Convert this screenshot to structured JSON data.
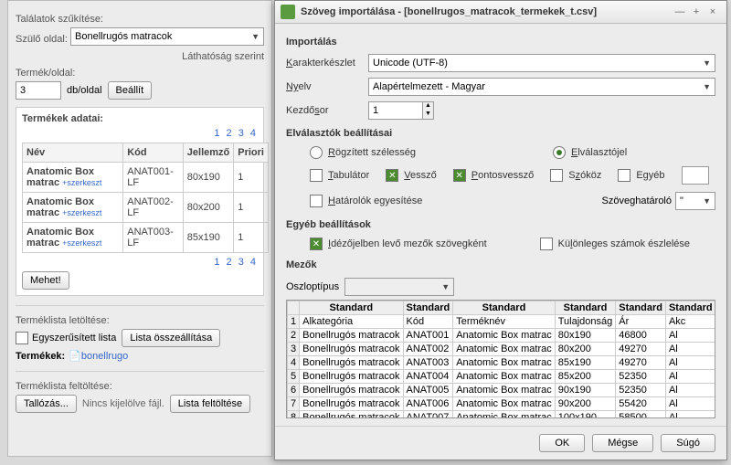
{
  "bg": {
    "filter_label": "Találatok szűkítése:",
    "parent_label": "Szülő oldal:",
    "parent_value": "Bonellrugós matracok",
    "visibility_label": "Láthatóság szerint",
    "perpage_label": "Termék/oldal:",
    "perpage_value": "3",
    "perpage_unit": "db/oldal",
    "set_btn": "Beállít",
    "products_title": "Termékek adatai:",
    "pager": [
      "1",
      "2",
      "3",
      "4"
    ],
    "cols": {
      "name": "Név",
      "code": "Kód",
      "attr": "Jellemző",
      "prio": "Priori"
    },
    "rows": [
      {
        "name": "Anatomic Box matrac",
        "edit": "+szerkeszt",
        "code": "ANAT001-LF",
        "attr": "80x190",
        "prio": "1"
      },
      {
        "name": "Anatomic Box matrac",
        "edit": "+szerkeszt",
        "code": "ANAT002-LF",
        "attr": "80x200",
        "prio": "1"
      },
      {
        "name": "Anatomic Box matrac",
        "edit": "+szerkeszt",
        "code": "ANAT003-LF",
        "attr": "85x190",
        "prio": "1"
      }
    ],
    "go_btn": "Mehet!",
    "download_label": "Terméklista letöltése:",
    "simplified": "Egyszerűsített lista",
    "compile_btn": "Lista összeállítása",
    "products_link_label": "Termékek:",
    "products_link": "bonellrugo",
    "upload_label": "Terméklista feltöltése:",
    "browse_btn": "Tallózás...",
    "no_file": "Nincs kijelölve fájl.",
    "upload_btn": "Lista feltöltése"
  },
  "dlg": {
    "title": "Szöveg importálása - [bonellrugos_matracok_termekek_t.csv]",
    "sec_import": "Importálás",
    "charset_label": "Karakterkészlet",
    "charset_value": "Unicode (UTF-8)",
    "lang_label": "Nyelv",
    "lang_value": "Alapértelmezett - Magyar",
    "startrow_label": "Kezdősor",
    "startrow_value": "1",
    "sec_sep": "Elválasztók beállításai",
    "fixed_width": "Rögzített szélesség",
    "delimiter": "Elválasztójel",
    "tab": "Tabulátor",
    "comma": "Vessző",
    "semicolon": "Pontosvessző",
    "space": "Szóköz",
    "other": "Egyéb",
    "merge_delim": "Határolók egyesítése",
    "text_delim_label": "Szöveghatároló",
    "text_delim_value": "\"",
    "sec_other": "Egyéb beállítások",
    "quoted_as_text": "Idézőjelben levő mezők szövegként",
    "special_numbers": "Különleges számok észlelése",
    "sec_fields": "Mezők",
    "coltype_label": "Oszloptípus",
    "std": "Standard",
    "headers": [
      "Alkategória",
      "Kód",
      "Terméknév",
      "Tulajdonság",
      "Ár",
      "Akc"
    ],
    "data": [
      [
        "Bonellrugós matracok",
        "ANAT001",
        "Anatomic Box matrac",
        "80x190",
        "46800",
        "Al"
      ],
      [
        "Bonellrugós matracok",
        "ANAT002",
        "Anatomic Box matrac",
        "80x200",
        "49270",
        "Al"
      ],
      [
        "Bonellrugós matracok",
        "ANAT003",
        "Anatomic Box matrac",
        "85x190",
        "49270",
        "Al"
      ],
      [
        "Bonellrugós matracok",
        "ANAT004",
        "Anatomic Box matrac",
        "85x200",
        "52350",
        "Al"
      ],
      [
        "Bonellrugós matracok",
        "ANAT005",
        "Anatomic Box matrac",
        "90x190",
        "52350",
        "Al"
      ],
      [
        "Bonellrugós matracok",
        "ANAT006",
        "Anatomic Box matrac",
        "90x200",
        "55420",
        "Al"
      ],
      [
        "Bonellrugós matracok",
        "ANAT007",
        "Anatomic Box matrac",
        "100x190",
        "58500",
        "Al"
      ]
    ],
    "ok": "OK",
    "cancel": "Mégse",
    "help": "Súgó"
  }
}
